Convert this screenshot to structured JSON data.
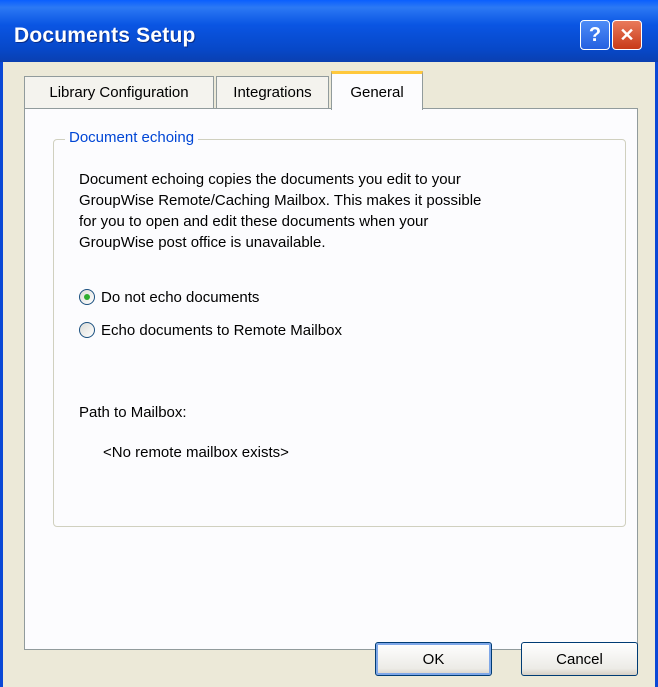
{
  "window": {
    "title": "Documents Setup",
    "help_symbol": "?",
    "close_symbol": "✕"
  },
  "tabs": [
    {
      "label": "Library Configuration",
      "active": false
    },
    {
      "label": "Integrations",
      "active": false
    },
    {
      "label": "General",
      "active": true
    }
  ],
  "general": {
    "group_title": "Document echoing",
    "description": "Document echoing copies the documents you edit to your\nGroupWise Remote/Caching Mailbox. This makes it possible\nfor you to open and edit these documents when your\nGroupWise post office is unavailable.",
    "options": [
      {
        "label": "Do not echo documents",
        "checked": true
      },
      {
        "label": "Echo documents to Remote Mailbox",
        "checked": false
      }
    ],
    "path_label": "Path to Mailbox:",
    "path_value": "<No remote mailbox exists>"
  },
  "buttons": {
    "ok": "OK",
    "cancel": "Cancel"
  },
  "colors": {
    "title_bar": "#0A55E3",
    "group_title": "#0046D5",
    "active_tab_highlight": "#FFC83C",
    "radio_dot": "#2EAE2E"
  }
}
